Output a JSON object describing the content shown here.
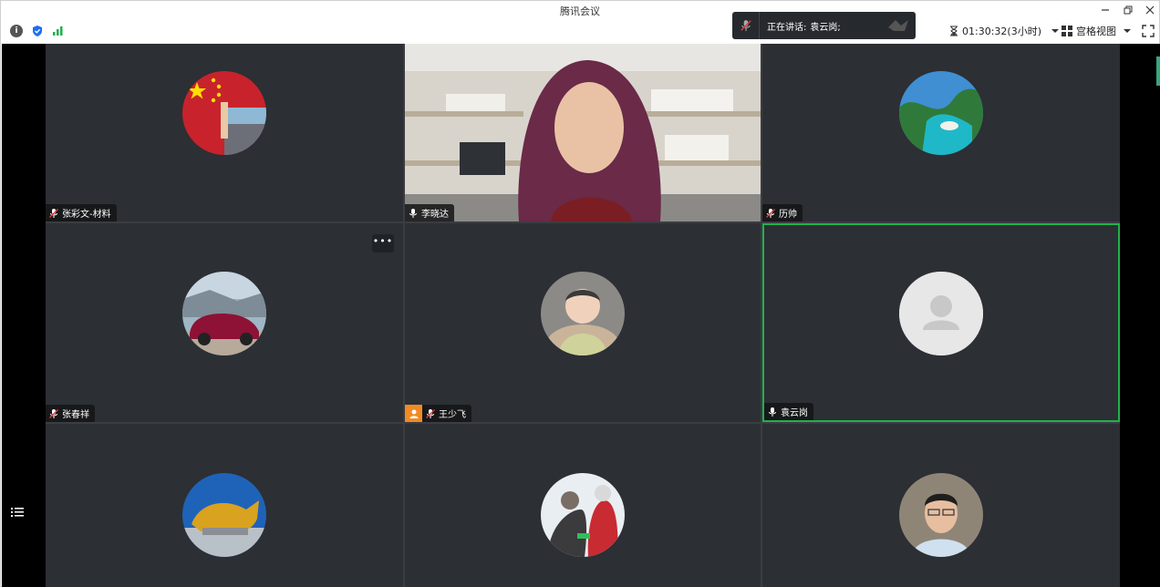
{
  "window": {
    "title": "腾讯会议"
  },
  "toolbar": {
    "timer": "01:30:32(3小时)",
    "view_label": "宫格视图"
  },
  "speaking": {
    "label": "正在讲话:",
    "name": "袁云岗;"
  },
  "participants": [
    {
      "name": "张彩文-材料",
      "mic": "muted"
    },
    {
      "name": "李晓达",
      "mic": "on",
      "video": true
    },
    {
      "name": "历帅",
      "mic": "muted"
    },
    {
      "name": "张春祥",
      "mic": "muted"
    },
    {
      "name": "王少飞",
      "mic": "muted",
      "host": true
    },
    {
      "name": "袁云岗",
      "mic": "on",
      "speaking": true
    },
    {
      "name": "",
      "mic": ""
    },
    {
      "name": "",
      "mic": ""
    },
    {
      "name": "",
      "mic": ""
    }
  ],
  "colors": {
    "active_border": "#22b14c",
    "host_badge": "#f08a24",
    "tile_bg": "#2c2f34"
  },
  "icons": {
    "info": "info-icon",
    "security": "shield-icon",
    "network": "signal-icon",
    "timer": "hourglass-icon",
    "view": "grid-view-icon",
    "fullscreen": "fullscreen-icon",
    "member_list": "list-icon"
  }
}
